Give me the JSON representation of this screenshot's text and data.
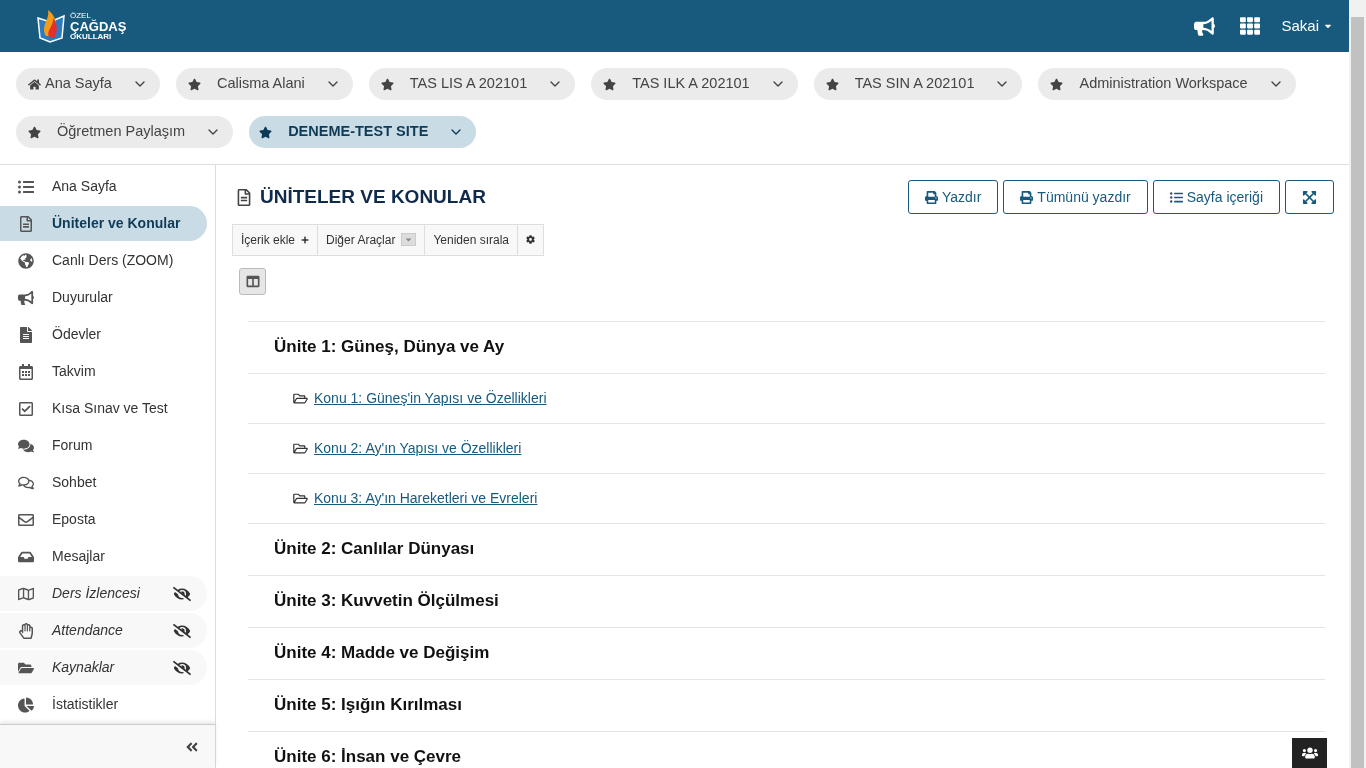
{
  "header": {
    "logo": {
      "small": "ÖZEL",
      "name": "ÇAĞDAŞ",
      "sub": "OKULLARI"
    },
    "user": "Sakai"
  },
  "sites": [
    {
      "label": "Ana Sayfa",
      "kind": "home",
      "selected": false
    },
    {
      "label": "Calisma Alani",
      "kind": "favorite",
      "selected": false
    },
    {
      "label": "TAS LIS A 202101",
      "kind": "favorite",
      "selected": false
    },
    {
      "label": "TAS ILK A 202101",
      "kind": "favorite",
      "selected": false
    },
    {
      "label": "TAS SIN A 202101",
      "kind": "favorite",
      "selected": false
    },
    {
      "label": "Administration Workspace",
      "kind": "favorite",
      "selected": false
    },
    {
      "label": "Öğretmen Paylaşım",
      "kind": "favorite",
      "selected": false
    },
    {
      "label": "DENEME-TEST SITE",
      "kind": "favorite",
      "selected": true
    }
  ],
  "sidebar": {
    "items": [
      {
        "label": "Ana Sayfa",
        "selected": false,
        "hidden": false
      },
      {
        "label": "Üniteler ve Konular",
        "selected": true,
        "hidden": false
      },
      {
        "label": "Canlı Ders (ZOOM)",
        "selected": false,
        "hidden": false
      },
      {
        "label": "Duyurular",
        "selected": false,
        "hidden": false
      },
      {
        "label": "Ödevler",
        "selected": false,
        "hidden": false
      },
      {
        "label": "Takvim",
        "selected": false,
        "hidden": false
      },
      {
        "label": "Kısa Sınav ve Test",
        "selected": false,
        "hidden": false
      },
      {
        "label": "Forum",
        "selected": false,
        "hidden": false
      },
      {
        "label": "Sohbet",
        "selected": false,
        "hidden": false
      },
      {
        "label": "Eposta",
        "selected": false,
        "hidden": false
      },
      {
        "label": "Mesajlar",
        "selected": false,
        "hidden": false
      },
      {
        "label": "Ders İzlencesi",
        "selected": false,
        "hidden": true
      },
      {
        "label": "Attendance",
        "selected": false,
        "hidden": true
      },
      {
        "label": "Kaynaklar",
        "selected": false,
        "hidden": true
      },
      {
        "label": "İstatistikler",
        "selected": false,
        "hidden": false
      }
    ]
  },
  "page": {
    "title": "ÜNİTELER VE KONULAR",
    "buttons": [
      {
        "label": "Yazdır",
        "kind": "print"
      },
      {
        "label": "Tümünü yazdır",
        "kind": "print"
      },
      {
        "label": "Sayfa içeriği",
        "kind": "list"
      },
      {
        "kind": "fullscreen"
      }
    ],
    "toolbar": [
      {
        "label": "İçerik ekle",
        "kind": "add"
      },
      {
        "label": "Diğer Araçlar",
        "kind": "dropdown"
      },
      {
        "label": "Yeniden sırala",
        "kind": "plain"
      },
      {
        "kind": "settings"
      }
    ],
    "units": [
      {
        "title": "Ünite 1: Güneş, Dünya ve Ay",
        "topics": [
          "Konu 1: Güneş'in Yapısı ve Özellikleri",
          "Konu 2: Ay'ın Yapısı ve Özellikleri",
          "Konu 3: Ay'ın Hareketleri ve Evreleri"
        ]
      },
      {
        "title": "Ünite 2: Canlılar Dünyası"
      },
      {
        "title": "Ünite 3: Kuvvetin Ölçülmesi"
      },
      {
        "title": "Ünite 4: Madde ve Değişim"
      },
      {
        "title": "Ünite 5: Işığın Kırılması"
      },
      {
        "title": "Ünite 6: İnsan ve Çevre"
      }
    ]
  }
}
